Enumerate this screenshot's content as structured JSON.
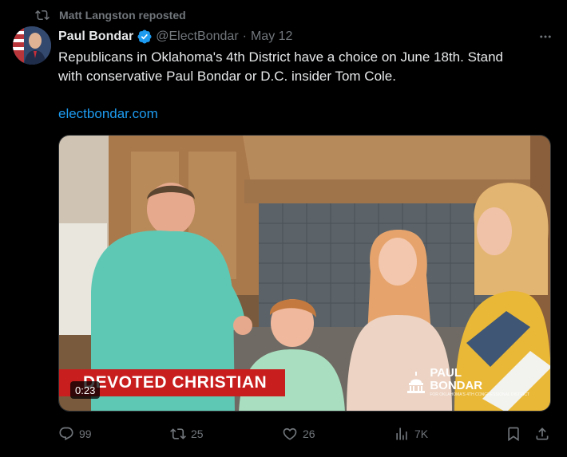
{
  "repost": {
    "text": "Matt Langston reposted",
    "icon": "repost-icon"
  },
  "author": {
    "name": "Paul Bondar",
    "handle": "@ElectBondar",
    "separator": "·",
    "date": "May 12",
    "verified": true
  },
  "tweet": {
    "text_line1": "Republicans in Oklahoma's 4th District have a choice on June 18th. Stand",
    "text_line2": "with conservative Paul Bondar or D.C. insider Tom Cole.",
    "link": "electbondar.com"
  },
  "video": {
    "lower_third": "DEVOTED CHRISTIAN",
    "duration": "0:23",
    "watermark_title_1": "PAUL",
    "watermark_title_2": "BONDAR",
    "watermark_subtitle": "FOR OKLAHOMA'S 4TH CONGRESSIONAL DISTRICT"
  },
  "actions": {
    "replies": "99",
    "reposts": "25",
    "likes": "26",
    "views": "7K"
  },
  "colors": {
    "background": "#000000",
    "text": "#e7e9ea",
    "muted": "#71767b",
    "link": "#1d9bf0",
    "banner_red": "#c81e1e"
  }
}
